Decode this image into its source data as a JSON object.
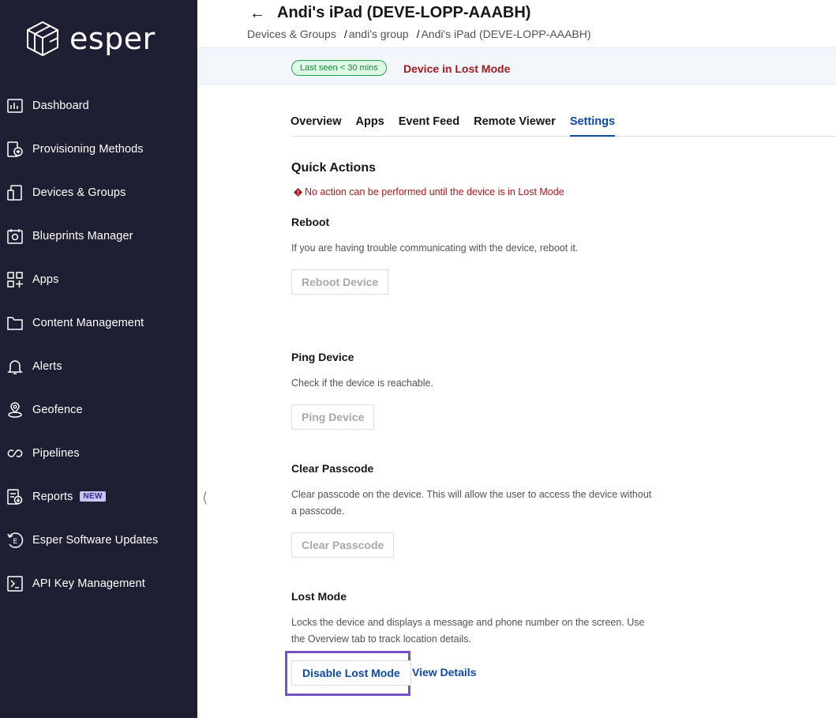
{
  "brand": {
    "name": "esper",
    "logo_icon": "esper-cube-logo"
  },
  "sidebar": {
    "items": [
      {
        "label": "Dashboard",
        "icon": "dashboard-icon"
      },
      {
        "label": "Provisioning Methods",
        "icon": "provisioning-icon"
      },
      {
        "label": "Devices & Groups",
        "icon": "devices-icon"
      },
      {
        "label": "Blueprints Manager",
        "icon": "blueprints-icon"
      },
      {
        "label": "Apps",
        "icon": "apps-icon"
      },
      {
        "label": "Content Management",
        "icon": "folder-icon"
      },
      {
        "label": "Alerts",
        "icon": "bell-icon"
      },
      {
        "label": "Geofence",
        "icon": "geofence-icon"
      },
      {
        "label": "Pipelines",
        "icon": "pipelines-icon"
      },
      {
        "label": "Reports",
        "icon": "reports-icon",
        "badge": "NEW"
      },
      {
        "label": "Esper Software Updates",
        "icon": "esper-updates-icon"
      },
      {
        "label": "API Key Management",
        "icon": "terminal-icon"
      }
    ]
  },
  "header": {
    "title": "Andi's iPad (DEVE-LOPP-AAABH)",
    "breadcrumb": [
      "Devices & Groups",
      "andi's group",
      "Andi's iPad (DEVE-LOPP-AAABH)"
    ],
    "breadcrumb_separator": "/"
  },
  "status": {
    "last_seen": "Last seen < 30 mins",
    "lost_mode": "Device in Lost Mode"
  },
  "tabs": [
    {
      "label": "Overview",
      "active": false
    },
    {
      "label": "Apps",
      "active": false
    },
    {
      "label": "Event Feed",
      "active": false
    },
    {
      "label": "Remote Viewer",
      "active": false
    },
    {
      "label": "Settings",
      "active": true
    }
  ],
  "quick_actions": {
    "title": "Quick Actions",
    "warning": "No action can be performed until the device is in Lost Mode",
    "reboot": {
      "title": "Reboot",
      "description": "If you are having trouble communicating with the device, reboot it.",
      "button": "Reboot Device"
    },
    "ping": {
      "title": "Ping Device",
      "description": "Check if the device is reachable.",
      "button": "Ping Device"
    },
    "clear_passcode": {
      "title": "Clear Passcode",
      "description": "Clear passcode on the device. This will allow the user to access the device without a passcode.",
      "button": "Clear Passcode"
    },
    "lost_mode": {
      "title": "Lost Mode",
      "description": "Locks the device and displays a message and phone number on the screen. Use the Overview tab to track location details.",
      "button": "Disable Lost Mode",
      "link": "View Details"
    }
  },
  "colors": {
    "sidebar_bg": "#1e1f33",
    "accent": "#0f4aa0",
    "error": "#a2191f",
    "success": "#198038",
    "highlight": "#7652c2"
  }
}
